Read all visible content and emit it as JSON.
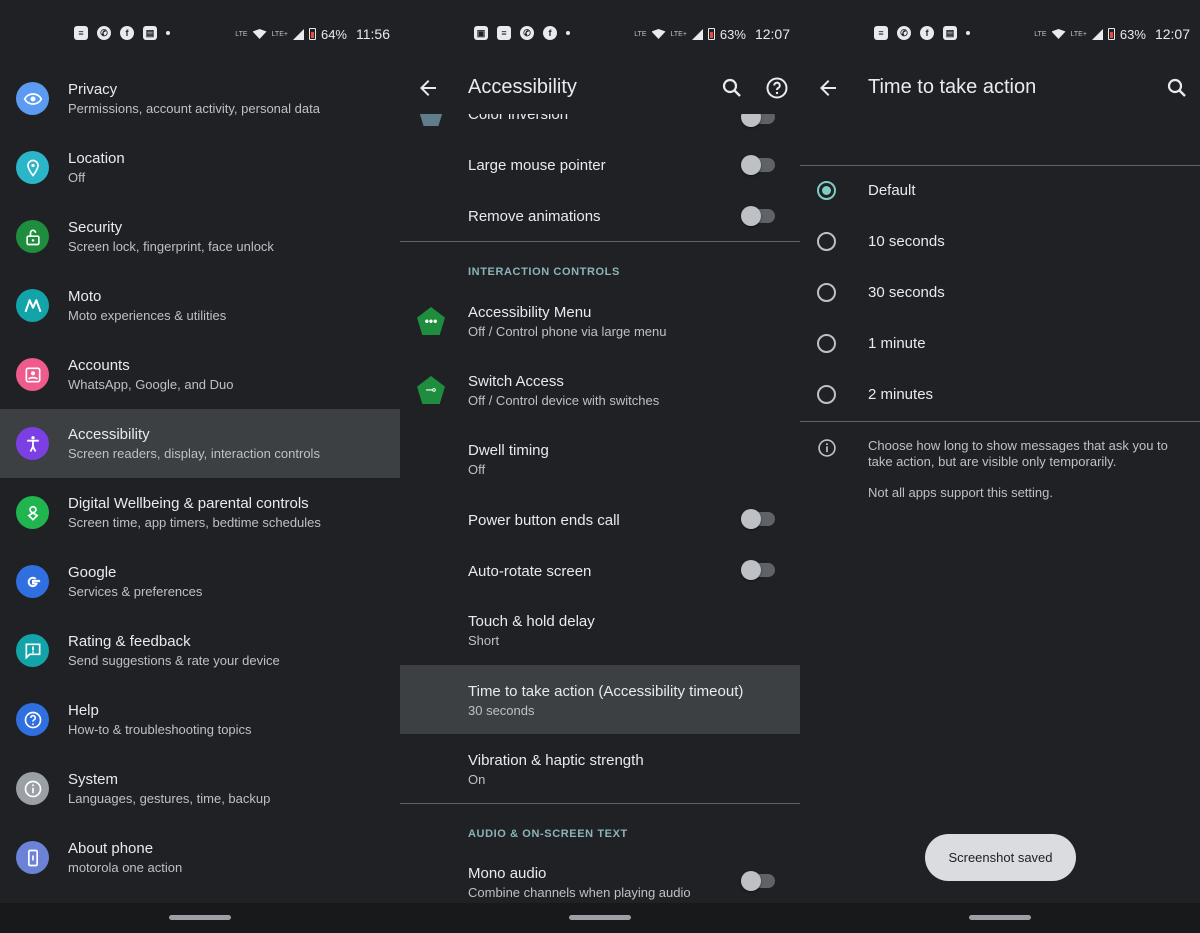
{
  "panel1": {
    "status": {
      "battery": "64%",
      "time": "11:56",
      "lte": "LTE",
      "lte_plus": "LTE+"
    },
    "items": [
      {
        "title": "Privacy",
        "subtitle": "Permissions, account activity, personal data",
        "icon": "privacy-eye-icon",
        "color": "#5b9cf2"
      },
      {
        "title": "Location",
        "subtitle": "Off",
        "icon": "location-pin-icon",
        "color": "#2bb5c9"
      },
      {
        "title": "Security",
        "subtitle": "Screen lock, fingerprint, face unlock",
        "icon": "security-lock-icon",
        "color": "#1e8e3e"
      },
      {
        "title": "Moto",
        "subtitle": "Moto experiences & utilities",
        "icon": "moto-logo-icon",
        "color": "#12a4a8"
      },
      {
        "title": "Accounts",
        "subtitle": "WhatsApp, Google, and Duo",
        "icon": "accounts-icon",
        "color": "#ee5b8c"
      },
      {
        "title": "Accessibility",
        "subtitle": "Screen readers, display, interaction controls",
        "icon": "accessibility-icon",
        "color": "#7b3fe4"
      },
      {
        "title": "Digital Wellbeing & parental controls",
        "subtitle": "Screen time, app timers, bedtime schedules",
        "icon": "wellbeing-heart-icon",
        "color": "#21b54f"
      },
      {
        "title": "Google",
        "subtitle": "Services & preferences",
        "icon": "google-g-icon",
        "color": "#2f6fe0"
      },
      {
        "title": "Rating & feedback",
        "subtitle": "Send suggestions & rate your device",
        "icon": "feedback-icon",
        "color": "#12a4a8"
      },
      {
        "title": "Help",
        "subtitle": "How-to & troubleshooting topics",
        "icon": "help-icon",
        "color": "#2f6fe0"
      },
      {
        "title": "System",
        "subtitle": "Languages, gestures, time, backup",
        "icon": "system-info-icon",
        "color": "#9aa0a6"
      },
      {
        "title": "About phone",
        "subtitle": "motorola one action",
        "icon": "phone-icon",
        "color": "#6b82d6"
      }
    ]
  },
  "panel2": {
    "status": {
      "battery": "63%",
      "time": "12:07",
      "lte": "LTE",
      "lte_plus": "LTE+"
    },
    "title": "Accessibility",
    "partial_item": "Color inversion",
    "large_mouse": "Large mouse pointer",
    "remove_animations": "Remove animations",
    "section_interaction": "INTERACTION CONTROLS",
    "acc_menu_title": "Accessibility Menu",
    "acc_menu_sub": "Off / Control phone via large menu",
    "switch_title": "Switch Access",
    "switch_sub": "Off / Control device with switches",
    "dwell_title": "Dwell timing",
    "dwell_sub": "Off",
    "power_btn": "Power button ends call",
    "auto_rotate": "Auto-rotate screen",
    "touch_hold_title": "Touch & hold delay",
    "touch_hold_sub": "Short",
    "time_action_title": "Time to take action (Accessibility timeout)",
    "time_action_sub": "30 seconds",
    "vibration_title": "Vibration & haptic strength",
    "vibration_sub": "On",
    "section_audio": "AUDIO & ON-SCREEN TEXT",
    "mono_title": "Mono audio",
    "mono_sub": "Combine channels when playing audio"
  },
  "panel3": {
    "status": {
      "battery": "63%",
      "time": "12:07",
      "lte": "LTE",
      "lte_plus": "LTE+"
    },
    "title": "Time to take action",
    "options": [
      "Default",
      "10 seconds",
      "30 seconds",
      "1 minute",
      "2 minutes"
    ],
    "selected": "Default",
    "info": "Choose how long to show messages that ask you to take action, but are visible only temporarily.",
    "note": "Not all apps support this setting.",
    "toast": "Screenshot saved"
  }
}
